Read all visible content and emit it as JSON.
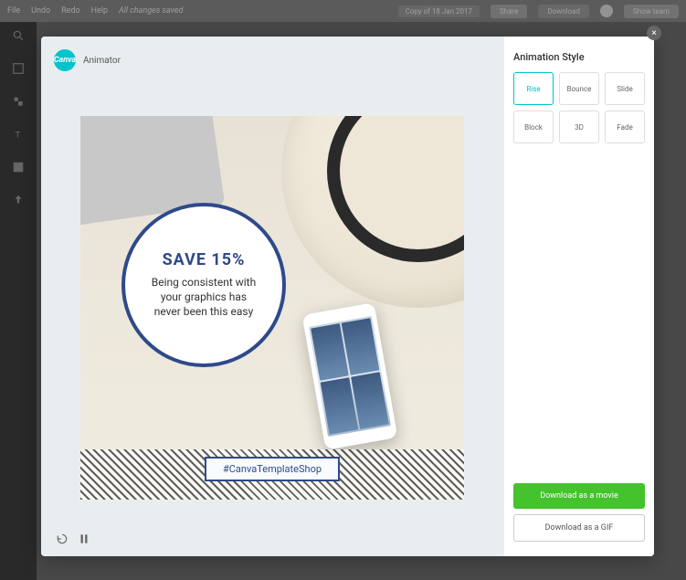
{
  "topbar": {
    "menu": [
      "File",
      "Undo",
      "Redo",
      "Help"
    ],
    "status": "All changes saved",
    "doc_title": "Copy of 18 Jan 2017",
    "share_label": "Share",
    "download_label": "Download",
    "user_label": "Show team"
  },
  "sidebar": {
    "items": [
      "Search",
      "Layouts",
      "Elements",
      "Text",
      "Background",
      "Uploads"
    ]
  },
  "modal": {
    "logo_name": "Canva",
    "modal_title": "Animator",
    "preview": {
      "badge_headline": "SAVE 15%",
      "badge_text": "Being consistent with your graphics has never been this easy",
      "hashtag": "#CanvaTemplateShop"
    },
    "animation_panel": {
      "title": "Animation Style",
      "styles": [
        "Rise",
        "Bounce",
        "Slide",
        "Block",
        "3D",
        "Fade"
      ],
      "selected": "Rise"
    },
    "download_movie_label": "Download as a movie",
    "download_gif_label": "Download as a GIF"
  }
}
